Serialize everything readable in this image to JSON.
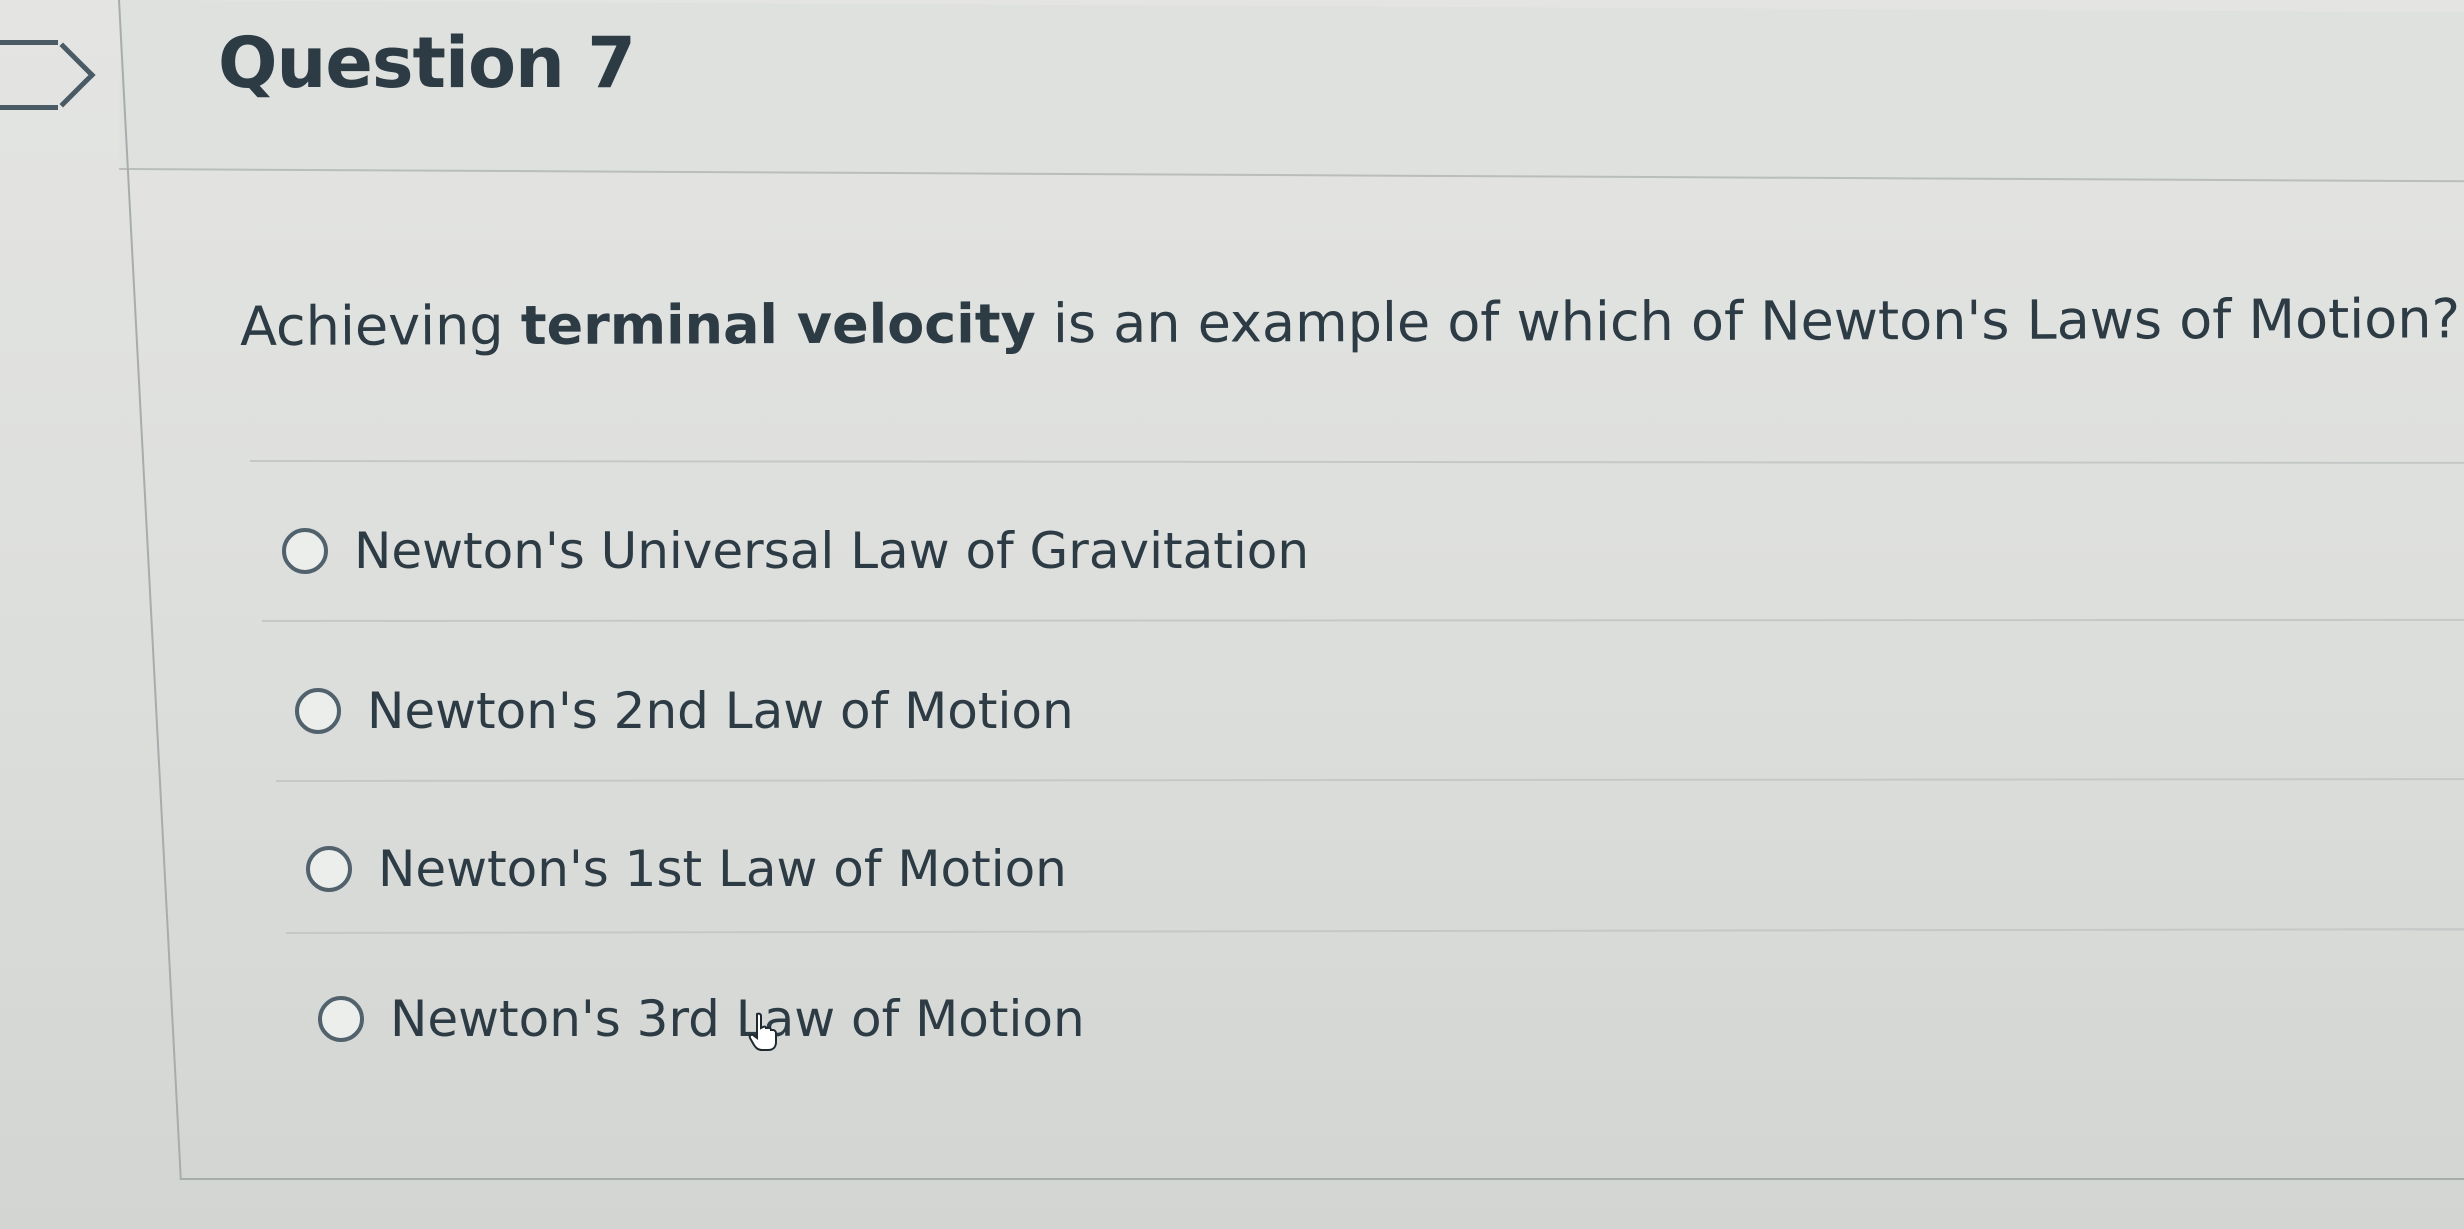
{
  "question": {
    "title": "Question 7",
    "text_before": "Achieving ",
    "text_bold": "terminal velocity",
    "text_after": " is an example of which of Newton's Laws of Motion?"
  },
  "answers": [
    {
      "label": "Newton's Universal Law of Gravitation",
      "selected": false
    },
    {
      "label": "Newton's 2nd Law of Motion",
      "selected": false
    },
    {
      "label": "Newton's 1st Law of Motion",
      "selected": false
    },
    {
      "label": "Newton's 3rd Law of Motion",
      "selected": false
    }
  ],
  "icons": {
    "flag": "bookmark-flag-icon",
    "radio": "radio-button-icon",
    "cursor": "hand-pointer-cursor-icon"
  },
  "colors": {
    "text": "#2d3b45",
    "radio_border": "#51626d",
    "background": "#dcdedc",
    "divider": "#c4c8c7"
  }
}
